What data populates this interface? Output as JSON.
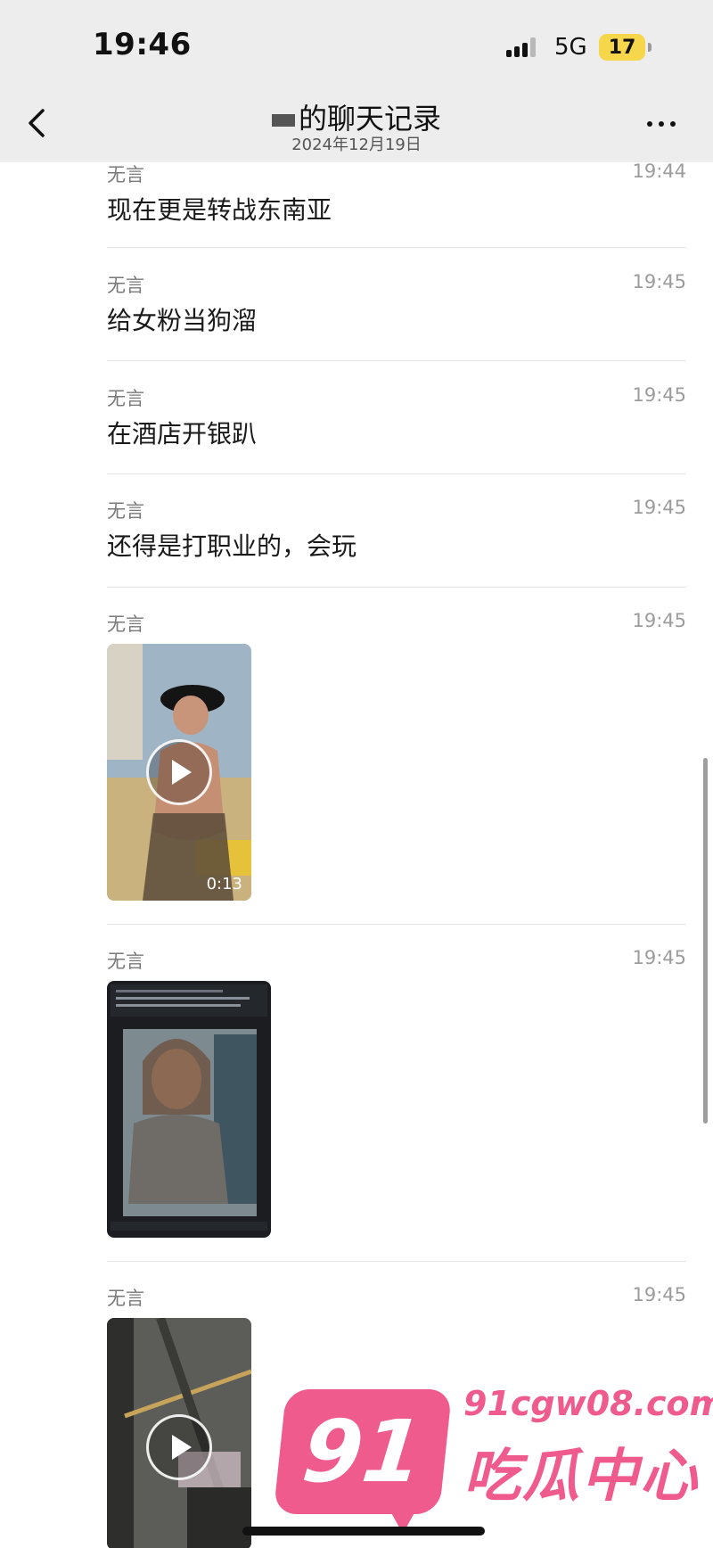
{
  "status_bar": {
    "time": "19:46",
    "network": "5G",
    "battery": "17"
  },
  "nav": {
    "title": "的聊天记录",
    "subtitle": "2024年12月19日"
  },
  "messages": [
    {
      "sender": "无言",
      "time": "19:44",
      "text": "现在更是转战东南亚"
    },
    {
      "sender": "无言",
      "time": "19:45",
      "text": "给女粉当狗溜"
    },
    {
      "sender": "无言",
      "time": "19:45",
      "text": "在酒店开银趴"
    },
    {
      "sender": "无言",
      "time": "19:45",
      "text": "还得是打职业的，会玩"
    },
    {
      "sender": "无言",
      "time": "19:45",
      "type": "video",
      "duration": "0:13"
    },
    {
      "sender": "无言",
      "time": "19:45",
      "type": "image"
    },
    {
      "sender": "无言",
      "time": "19:45",
      "type": "video"
    }
  ],
  "watermark": {
    "badge": "91",
    "domain": "91cgw08.com",
    "name": "吃瓜中心"
  },
  "colors": {
    "header_bg": "#ededed",
    "battery": "#f6d64a",
    "watermark": "#ef5b8c"
  }
}
